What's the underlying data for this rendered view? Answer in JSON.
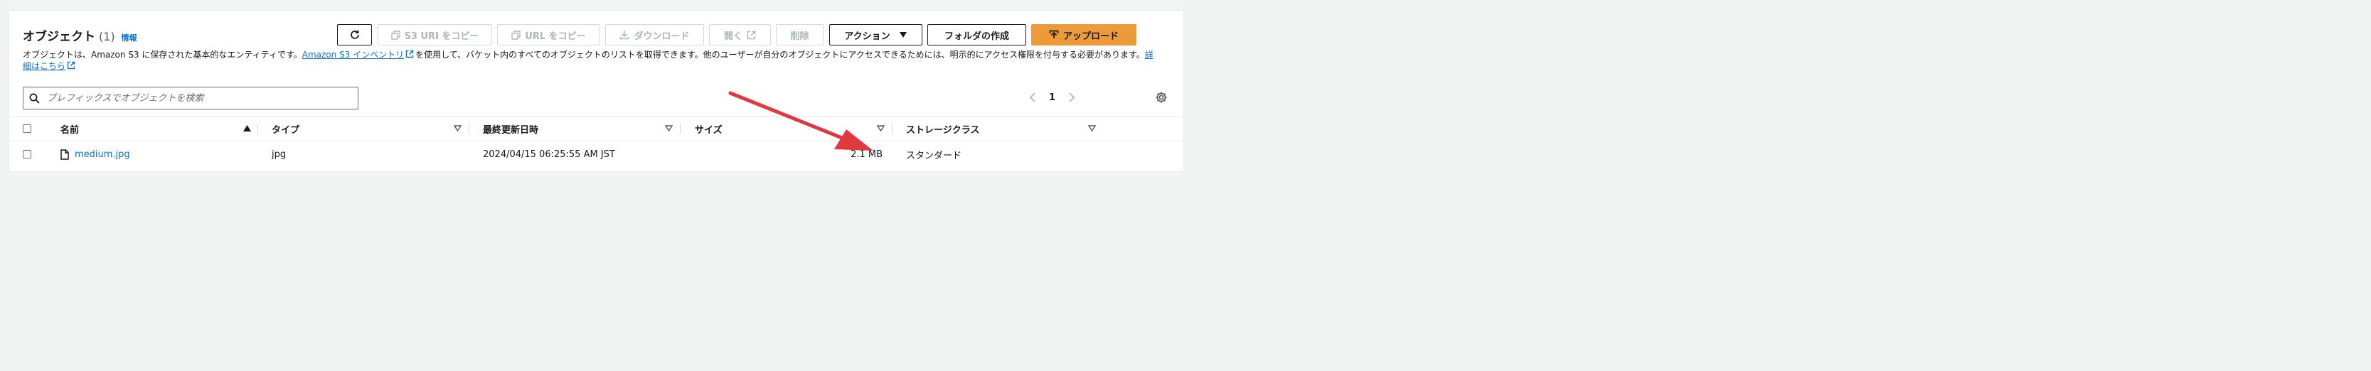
{
  "header": {
    "title": "オブジェクト",
    "count": "(1)",
    "info_label": "情報"
  },
  "toolbar": {
    "copy_s3_uri": "S3 URI をコピー",
    "copy_url": "URL をコピー",
    "download": "ダウンロード",
    "open": "開く",
    "delete": "削除",
    "actions": "アクション",
    "create_folder": "フォルダの作成",
    "upload": "アップロード"
  },
  "description": {
    "part1": "オブジェクトは、Amazon S3 に保存された基本的なエンティティです。",
    "inventory_link": "Amazon S3 インベントリ",
    "part2": "を使用して、バケット内のすべてのオブジェクトのリストを取得できます。他のユーザーが自分のオブジェクトにアクセスできるためには、明示的にアクセス権限を付与する必要があります。",
    "details_link": "詳細はこちら"
  },
  "search": {
    "placeholder": "プレフィックスでオブジェクトを検索"
  },
  "pagination": {
    "current_page": "1"
  },
  "table": {
    "columns": [
      "名前",
      "タイプ",
      "最終更新日時",
      "サイズ",
      "ストレージクラス"
    ],
    "rows": [
      {
        "name": "medium.jpg",
        "type": "jpg",
        "last_modified": "2024/04/15 06:25:55 AM JST",
        "size": "2.1 MB",
        "storage_class": "スタンダード"
      }
    ]
  },
  "colors": {
    "link": "#0972d3",
    "primary_button": "#ec9a3a",
    "annotation_arrow": "#e0383e"
  }
}
